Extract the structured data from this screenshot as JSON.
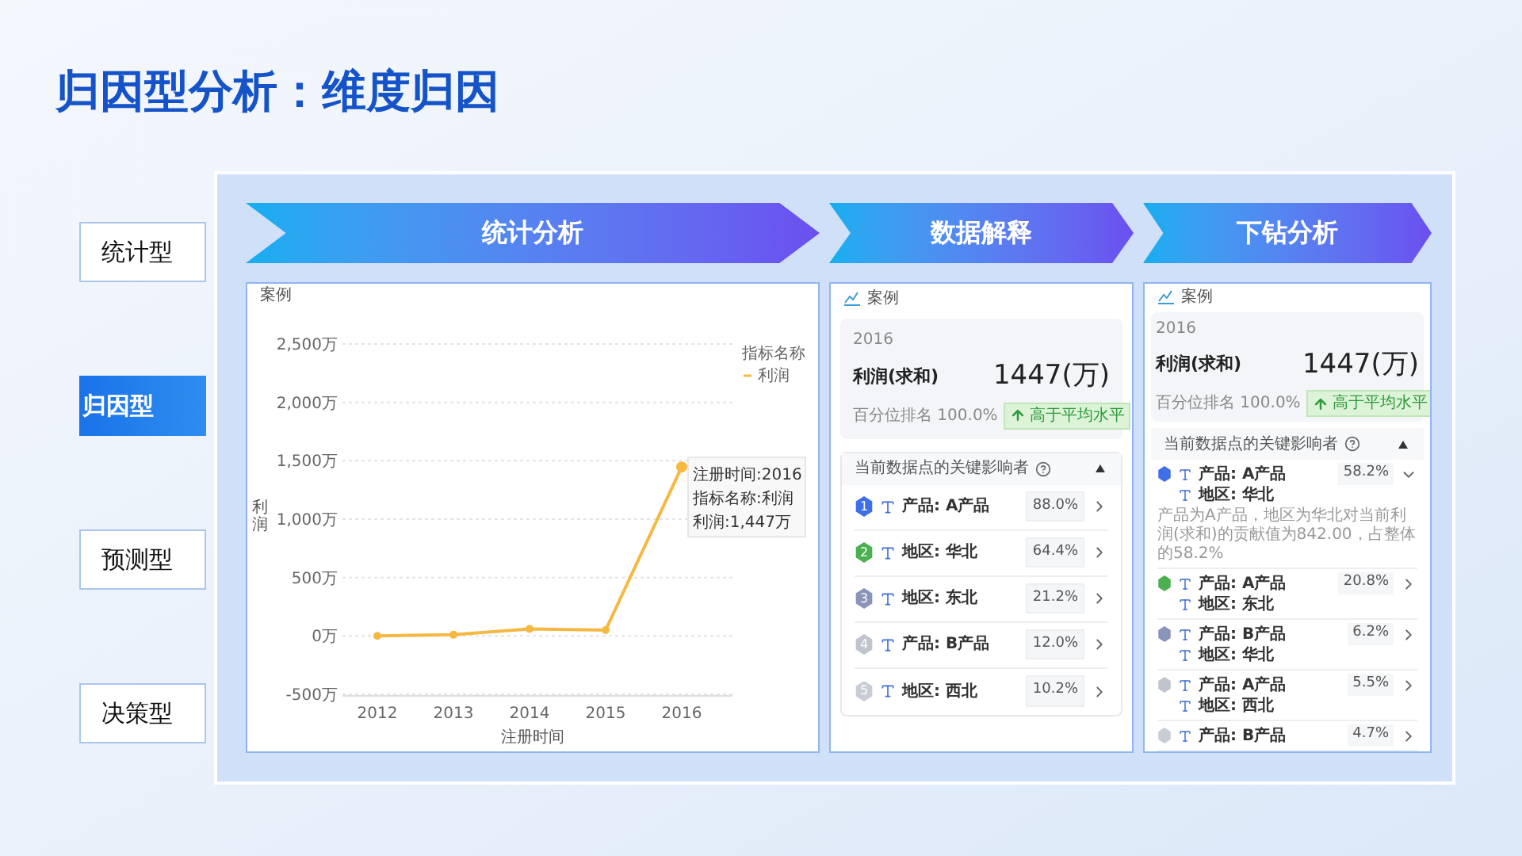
{
  "title": "归因型分析：维度归因",
  "side_tabs": [
    {
      "label": "统计型",
      "selected": false
    },
    {
      "label": "归因型",
      "selected": true
    },
    {
      "label": "预测型",
      "selected": false
    },
    {
      "label": "决策型",
      "selected": false
    }
  ],
  "stages": [
    {
      "label": "统计分析"
    },
    {
      "label": "数据解释"
    },
    {
      "label": "下钻分析"
    }
  ],
  "chart_card": {
    "title": "案例",
    "legend_title": "指标名称",
    "tooltip": [
      "注册时间:2016",
      "指标名称:利润",
      "利润:1,447万"
    ],
    "chart_data": {
      "type": "line",
      "xlabel": "注册时间",
      "ylabel": "利润",
      "categories": [
        "2012",
        "2013",
        "2014",
        "2015",
        "2016"
      ],
      "grid": true,
      "series": [
        {
          "name": "利润",
          "color": "#f5b942",
          "marker": "circle",
          "values": [
            0,
            10,
            60,
            50,
            1447
          ]
        }
      ],
      "ylim": [
        -500,
        2500
      ],
      "yticks": [
        {
          "value": -500,
          "label": "-500万"
        },
        {
          "value": 0,
          "label": "0万"
        },
        {
          "value": 500,
          "label": "500万"
        },
        {
          "value": 1000,
          "label": "1,000万"
        },
        {
          "value": 1500,
          "label": "1,500万"
        },
        {
          "value": 2000,
          "label": "2,000万"
        },
        {
          "value": 2500,
          "label": "2,500万"
        }
      ]
    }
  },
  "explain_card": {
    "title": "案例",
    "year": "2016",
    "metric": "利润(求和)",
    "value": "1447(万)",
    "rank": "百分位排名 100.0%",
    "badge": "高于平均水平",
    "influencers_title": "当前数据点的关键影响者",
    "expanded": true,
    "items": [
      {
        "rank": "1",
        "color": "#3f6fe8",
        "dims": [
          "产品: A产品"
        ],
        "share": "88.0%",
        "expanded": false
      },
      {
        "rank": "2",
        "color": "#4cb050",
        "dims": [
          "地区: 华北"
        ],
        "share": "64.4%",
        "expanded": false
      },
      {
        "rank": "3",
        "color": "#8a94b8",
        "dims": [
          "地区: 东北"
        ],
        "share": "21.2%",
        "expanded": false
      },
      {
        "rank": "4",
        "color": "#c0c4cc",
        "dims": [
          "产品: B产品"
        ],
        "share": "12.0%",
        "expanded": false
      },
      {
        "rank": "5",
        "color": "#c8ccd4",
        "dims": [
          "地区: 西北"
        ],
        "share": "10.2%",
        "expanded": false
      }
    ]
  },
  "drill_card": {
    "title": "案例",
    "year": "2016",
    "metric": "利润(求和)",
    "value": "1447(万)",
    "rank": "百分位排名 100.0%",
    "badge": "高于平均水平",
    "influencers_title": "当前数据点的关键影响者",
    "expanded": true,
    "items": [
      {
        "color": "#3f6fe8",
        "dims": [
          "产品: A产品",
          "地区: 华北"
        ],
        "share": "58.2%",
        "expanded": true,
        "description": "产品为A产品，地区为华北对当前利润(求和)的贡献值为842.00，占整体的58.2%"
      },
      {
        "color": "#4cb050",
        "dims": [
          "产品: A产品",
          "地区: 东北"
        ],
        "share": "20.8%",
        "expanded": false
      },
      {
        "color": "#8a94b8",
        "dims": [
          "产品: B产品",
          "地区: 华北"
        ],
        "share": "6.2%",
        "expanded": false
      },
      {
        "color": "#c0c4cc",
        "dims": [
          "产品: A产品",
          "地区: 西北"
        ],
        "share": "5.5%",
        "expanded": false
      },
      {
        "color": "#c8ccd4",
        "dims": [
          "产品: B产品"
        ],
        "share": "4.7%",
        "expanded": false
      }
    ]
  }
}
